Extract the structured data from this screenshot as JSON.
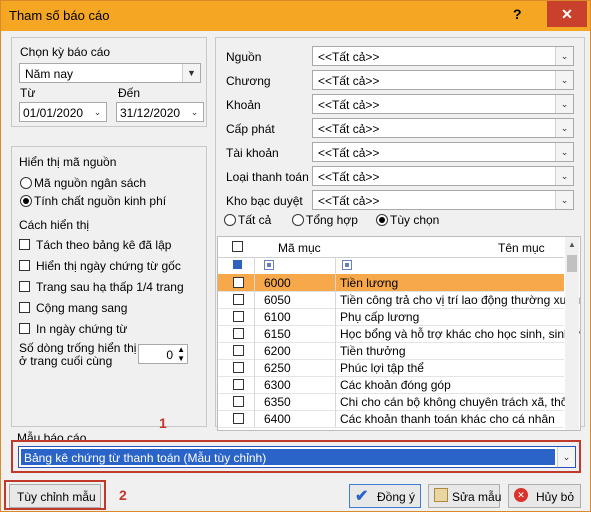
{
  "window": {
    "title": "Tham số báo cáo",
    "help": "?",
    "close": "✕"
  },
  "period": {
    "label": "Chọn kỳ báo cáo",
    "value": "Năm nay",
    "from_label": "Từ",
    "to_label": "Đến",
    "from_value": "01/01/2020",
    "to_value": "31/12/2020"
  },
  "display": {
    "source_title": "Hiển thị mã nguồn",
    "source_options": [
      "Mã nguồn ngân sách",
      "Tính chất nguồn kinh phí"
    ],
    "source_selected": 1,
    "mode_title": "Cách hiển thị",
    "checkboxes": [
      "Tách theo bảng kê đã lập",
      "Hiển thị ngày chứng từ gốc",
      "Trang sau hạ thấp 1/4 trang",
      "Cộng mang sang",
      "In ngày chứng từ"
    ],
    "blank_rows_label_1": "Số dòng trống hiển thị",
    "blank_rows_label_2": "ở trang cuối cùng",
    "blank_rows_value": "0"
  },
  "filters": [
    {
      "label": "Nguồn",
      "value": "<<Tất cả>>"
    },
    {
      "label": "Chương",
      "value": "<<Tất cả>>"
    },
    {
      "label": "Khoản",
      "value": "<<Tất cả>>"
    },
    {
      "label": "Cấp phát",
      "value": "<<Tất cả>>"
    },
    {
      "label": "Tài khoản",
      "value": "<<Tất cả>>"
    },
    {
      "label": "Loại thanh toán",
      "value": "<<Tất cả>>"
    },
    {
      "label": "Kho bạc duyệt",
      "value": "<<Tất cả>>"
    }
  ],
  "scope": {
    "options": [
      "Tất cả",
      "Tổng hợp",
      "Tùy chọn"
    ],
    "selected": 2
  },
  "grid": {
    "col_code": "Mã mục",
    "col_name": "Tên mục",
    "rows": [
      {
        "code": "6000",
        "name": "Tiền lương"
      },
      {
        "code": "6050",
        "name": "Tiền công trả cho vị trí lao động thường xuyên"
      },
      {
        "code": "6100",
        "name": "Phụ cấp lương"
      },
      {
        "code": "6150",
        "name": "Học bổng và hỗ trợ khác cho học sinh, sinh vi"
      },
      {
        "code": "6200",
        "name": "Tiền thưởng"
      },
      {
        "code": "6250",
        "name": "Phúc lợi tập thể"
      },
      {
        "code": "6300",
        "name": "Các khoản đóng góp"
      },
      {
        "code": "6350",
        "name": "Chi cho cán bộ không chuyên trách xã, thôn, b"
      },
      {
        "code": "6400",
        "name": "Các khoản thanh toán khác cho cá nhân"
      }
    ],
    "selected_row": 0
  },
  "template": {
    "label": "Mẫu báo cáo",
    "value": "Bảng kê chứng từ thanh toán (Mẫu tùy chỉnh)"
  },
  "annotations": {
    "one": "1",
    "two": "2"
  },
  "buttons": {
    "customize": "Tùy chỉnh mẫu",
    "ok": "Đồng ý",
    "edit": "Sửa mẫu",
    "cancel": "Hủy bỏ"
  }
}
